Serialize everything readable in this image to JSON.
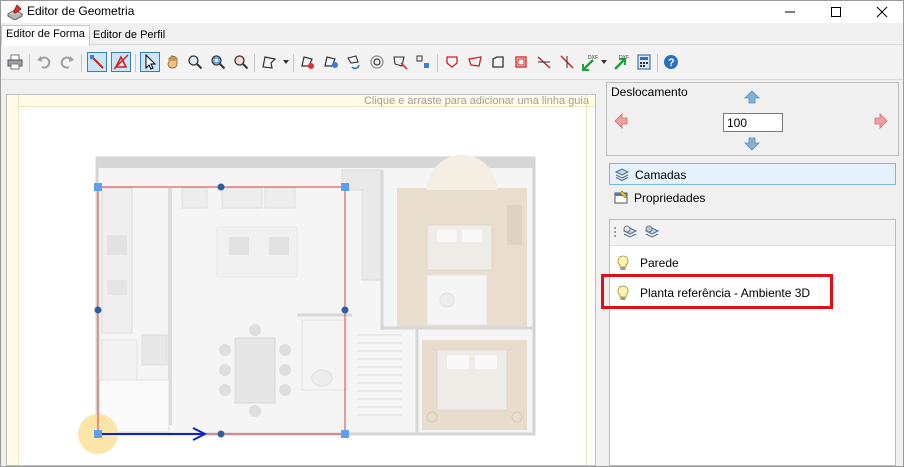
{
  "window": {
    "title": "Editor de Geometria",
    "icon": "geometry-editor-icon"
  },
  "tabs": [
    {
      "label": "Editor de Forma",
      "active": true
    },
    {
      "label": "Editor de Perfil",
      "active": false
    }
  ],
  "toolbar": {
    "icons": [
      "print-icon",
      "undo-icon",
      "redo-icon",
      "snap-icon",
      "snap-off-icon",
      "select-arrow-icon",
      "pan-hand-icon",
      "zoom-icon",
      "zoom-window-icon",
      "zoom-extents-icon",
      "polyline-icon",
      "add-vertex-icon",
      "move-vertex-icon",
      "rotate-icon",
      "offset-icon",
      "trim-icon",
      "align-icon",
      "shape-icon",
      "shape2-icon",
      "shape3-icon",
      "shape4-icon",
      "cut-icon",
      "cut2-icon",
      "dxf-import-icon",
      "dxf-export-icon",
      "calc-icon",
      "help-icon"
    ]
  },
  "canvas": {
    "hint": "Clique e arraste para adicionar uma linha guia"
  },
  "deslocamento": {
    "label": "Deslocamento",
    "value": "100"
  },
  "panels": {
    "camadas": "Camadas",
    "propriedades": "Propriedades"
  },
  "layers": [
    {
      "label": "Parede",
      "icon": "lightbulb-icon"
    },
    {
      "label": "Planta referência - Ambiente 3D",
      "icon": "lightbulb-icon"
    }
  ],
  "colors": {
    "selection": "#e04040",
    "handle": "#5ea0f0",
    "arrow": "#1020d0",
    "highlight": "#e0101a"
  }
}
